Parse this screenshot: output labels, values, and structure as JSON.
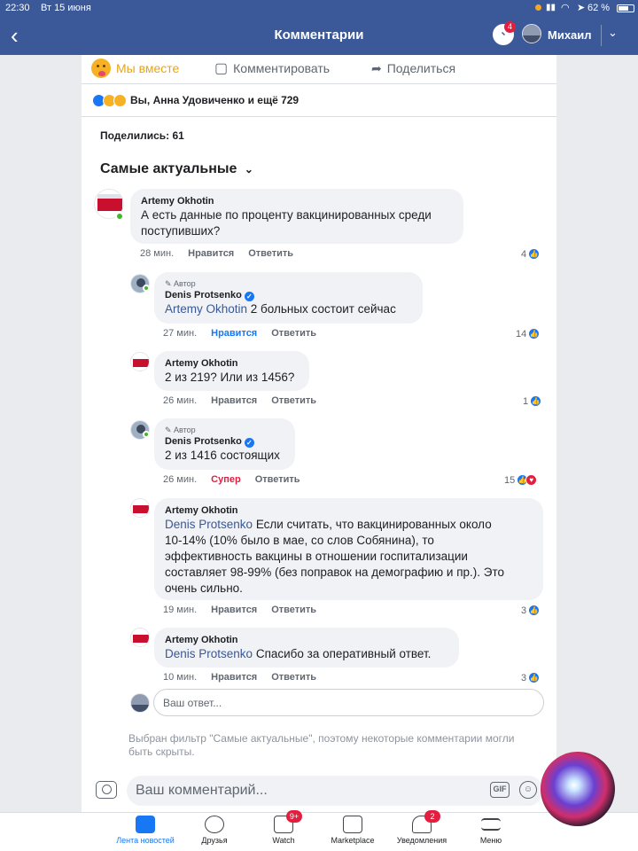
{
  "status_bar": {
    "time": "22:30",
    "date": "Вт 15 июня",
    "battery": "62 %"
  },
  "nav": {
    "title": "Комментарии",
    "messenger_badge": "4",
    "user_name": "Михаил"
  },
  "actions": {
    "reaction_label": "Мы вместе",
    "comment_label": "Комментировать",
    "share_label": "Поделиться"
  },
  "reactions_summary": "Вы, Анна Удовиченко и ещё 729",
  "shared": "Поделились: 61",
  "filter_label": "Самые актуальные",
  "comments": [
    {
      "author": "Artemy Okhotin",
      "text": "А есть данные по проценту вакцинированных среди поступивших?",
      "time": "28 мин.",
      "like": "Нравится",
      "reply": "Ответить",
      "count": "4"
    },
    {
      "badge": "Автор",
      "author": "Denis Protsenko",
      "mention": "Artemy Okhotin",
      "text": " 2 больных состоит сейчас",
      "time": "27 мин.",
      "like": "Нравится",
      "reply": "Ответить",
      "count": "14"
    },
    {
      "author": "Artemy Okhotin",
      "text": "2 из 219? Или из 1456?",
      "time": "26 мин.",
      "like": "Нравится",
      "reply": "Ответить",
      "count": "1"
    },
    {
      "badge": "Автор",
      "author": "Denis Protsenko",
      "text": "2 из 1416 состоящих",
      "time": "26 мин.",
      "like": "Супер",
      "reply": "Ответить",
      "count": "15"
    },
    {
      "author": "Artemy Okhotin",
      "mention": "Denis Protsenko",
      "text_lines": [
        " Если считать, что вакцинированных около",
        "10-14% (10% было в мае, со слов Собянина), то",
        "эффективность вакцины в отношении госпитализации",
        "составляет 98-99% (без поправок на демографию и пр.). Это",
        "очень сильно."
      ],
      "time": "19 мин.",
      "like": "Нравится",
      "reply": "Ответить",
      "count": "3"
    },
    {
      "author": "Artemy Okhotin",
      "mention": "Denis Protsenko",
      "text": " Спасибо за оперативный ответ.",
      "time": "10 мин.",
      "like": "Нравится",
      "reply": "Ответить",
      "count": "3"
    }
  ],
  "reply_placeholder": "Ваш ответ...",
  "filter_note": "Выбран фильтр \"Самые актуальные\", поэтому некоторые комментарии могли быть скрыты.",
  "composer_placeholder": "Ваш комментарий...",
  "gif_label": "GIF",
  "tabs": [
    {
      "label": "Лента новостей"
    },
    {
      "label": "Друзья"
    },
    {
      "label": "Watch",
      "badge": "9+"
    },
    {
      "label": "Marketplace"
    },
    {
      "label": "Уведомления",
      "badge": "2"
    },
    {
      "label": "Меню"
    }
  ],
  "colors": {
    "brand": "#3b5998",
    "link": "#1877f2",
    "love": "#e41e3f",
    "reaction": "#f7b125"
  }
}
